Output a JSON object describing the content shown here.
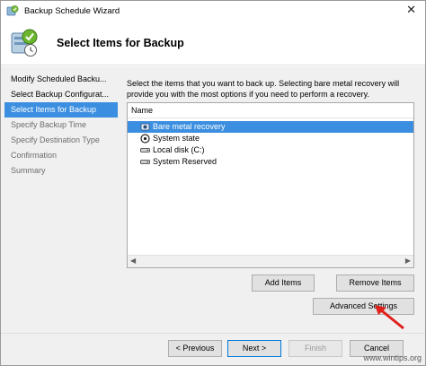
{
  "window": {
    "title": "Backup Schedule Wizard",
    "close_glyph": "✕"
  },
  "header": {
    "title": "Select Items for Backup",
    "icon": "backup-wizard-icon"
  },
  "nav": {
    "items": [
      {
        "label": "Modify Scheduled Backu...",
        "state": "done"
      },
      {
        "label": "Select Backup Configurat...",
        "state": "done"
      },
      {
        "label": "Select Items for Backup",
        "state": "selected"
      },
      {
        "label": "Specify Backup Time",
        "state": "future"
      },
      {
        "label": "Specify Destination Type",
        "state": "future"
      },
      {
        "label": "Confirmation",
        "state": "future"
      },
      {
        "label": "Summary",
        "state": "future"
      }
    ]
  },
  "main": {
    "description": "Select the items that you want to back up. Selecting bare metal recovery will provide you with the most options if you need to perform a recovery.",
    "list": {
      "column_header": "Name",
      "items": [
        {
          "label": "Bare metal recovery",
          "icon": "bare-metal-icon",
          "highlighted": true
        },
        {
          "label": "System state",
          "icon": "system-state-icon",
          "highlighted": false
        },
        {
          "label": "Local disk (C:)",
          "icon": "drive-icon",
          "highlighted": false
        },
        {
          "label": "System Reserved",
          "icon": "drive-icon",
          "highlighted": false
        }
      ]
    },
    "buttons": {
      "add_items": "Add Items",
      "remove_items": "Remove Items",
      "advanced_settings": "Advanced Settings"
    }
  },
  "footer": {
    "previous": "< Previous",
    "next": "Next >",
    "finish": "Finish",
    "cancel": "Cancel"
  },
  "watermark": "www.wintips.org",
  "colors": {
    "selection": "#3c8fe0",
    "annotation_arrow": "#e0201b"
  }
}
